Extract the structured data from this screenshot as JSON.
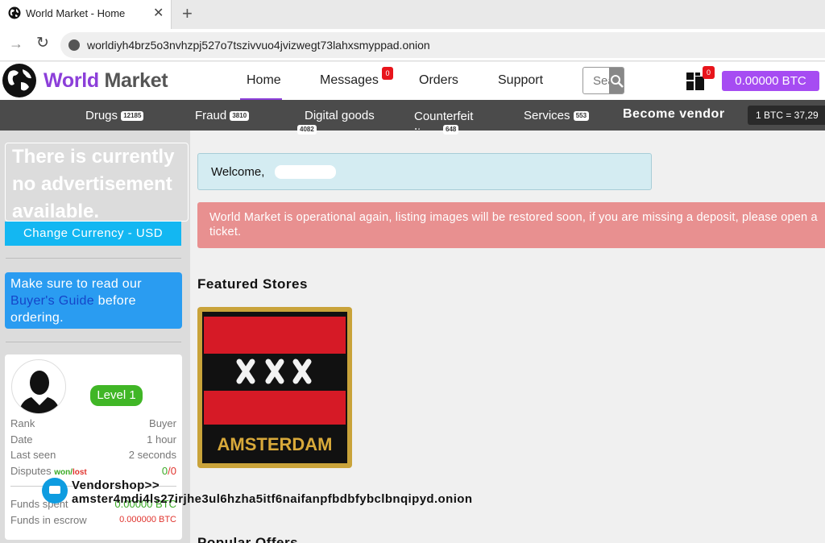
{
  "browser": {
    "tab_title": "World Market - Home",
    "url": "worldiyh4brz5o3nvhzpj527o7tszivvuo4jvizwegt73lahxsmyppad.onion"
  },
  "header": {
    "logo_world": "World",
    "logo_market": "Market",
    "nav": [
      "Home",
      "Messages",
      "Orders",
      "Support"
    ],
    "messages_badge": "0",
    "search_placeholder": "Search",
    "cart_badge": "0",
    "btc_balance": "0.00000 BTC"
  },
  "categories": {
    "items": [
      {
        "label": "Drugs",
        "count": "12185"
      },
      {
        "label": "Fraud",
        "count": "3810"
      },
      {
        "label": "Digital goods",
        "count": "4082"
      },
      {
        "label": "Counterfeit Items",
        "count": "648"
      },
      {
        "label": "Services",
        "count": "553"
      }
    ],
    "become_vendor": "Become vendor",
    "rate": "1 BTC = 37,29"
  },
  "sidebar": {
    "ad_text": "There is currently no advertisement available.",
    "currency_button": "Change Currency - USD",
    "guide_pre": "Make sure to read our ",
    "guide_link": "Buyer's Guide",
    "guide_post": " before ordering.",
    "level": "Level 1",
    "profile": {
      "rank_label": "Rank",
      "rank_value": "Buyer",
      "date_label": "Date",
      "date_value": "1 hour",
      "lastseen_label": "Last seen",
      "lastseen_value": "2 seconds",
      "disputes_label": "Disputes",
      "won": "won",
      "slash": "/",
      "lost": "lost",
      "disputes_won": "0",
      "disputes_lost": "0",
      "funds_spent_label": "Funds spent",
      "funds_spent_value": "0.00000 BTC",
      "escrow_label": "Funds in escrow",
      "escrow_value": "0.000000 BTC"
    }
  },
  "main": {
    "welcome": "Welcome,",
    "alert": "World Market is operational again, listing images will be restored soon, if you are missing a deposit, please open a ticket.",
    "featured_title": "Featured Stores",
    "store_banner_text": "AMSTERDAM",
    "vendorshop_label": "Vendorshop>>",
    "vendorshop_url": "amster4mdi4ls27irjhe3ul6hzha5itf6naifanpfbdbfybclbnqipyd.onion",
    "popular_title": "Popular Offers"
  },
  "colors": {
    "accent": "#8c3fd9",
    "btc_button": "#a64cf2",
    "category_bar": "#4b4b4b",
    "currency_button": "#13b7f2",
    "alert": "#e89090",
    "level": "#40b626"
  }
}
